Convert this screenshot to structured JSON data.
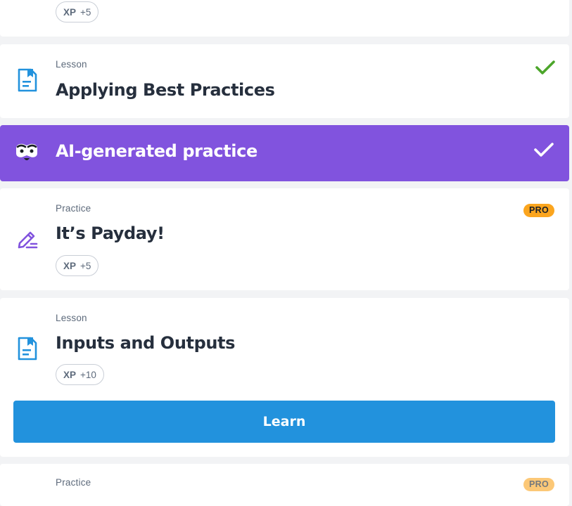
{
  "colors": {
    "background": "#f2f3f5",
    "card": "#ffffff",
    "ai_bar": "#8153de",
    "learn_button": "#2292dd",
    "check_green": "#4ca62b",
    "pro_badge": "#fba51e",
    "lesson_icon": "#2292dd",
    "practice_icon": "#8153de"
  },
  "cards": {
    "prev_card": {
      "xp_label": "XP",
      "xp_value": "+5"
    },
    "applying_best_practices": {
      "kind": "Lesson",
      "title": "Applying Best Practices",
      "icon": "lesson-icon",
      "status": "completed-check-icon"
    },
    "ai_practice": {
      "title": "AI-generated practice",
      "icon": "ai-robot-icon",
      "status": "completed-check-icon"
    },
    "its_payday": {
      "kind": "Practice",
      "title": "It’s Payday!",
      "icon": "practice-pencil-icon",
      "badge": "PRO",
      "xp_label": "XP",
      "xp_value": "+5"
    },
    "inputs_outputs": {
      "kind": "Lesson",
      "title": "Inputs and Outputs",
      "icon": "lesson-icon",
      "xp_label": "XP",
      "xp_value": "+10",
      "button_label": "Learn"
    },
    "next_card": {
      "kind": "Practice",
      "badge": "PRO"
    }
  }
}
